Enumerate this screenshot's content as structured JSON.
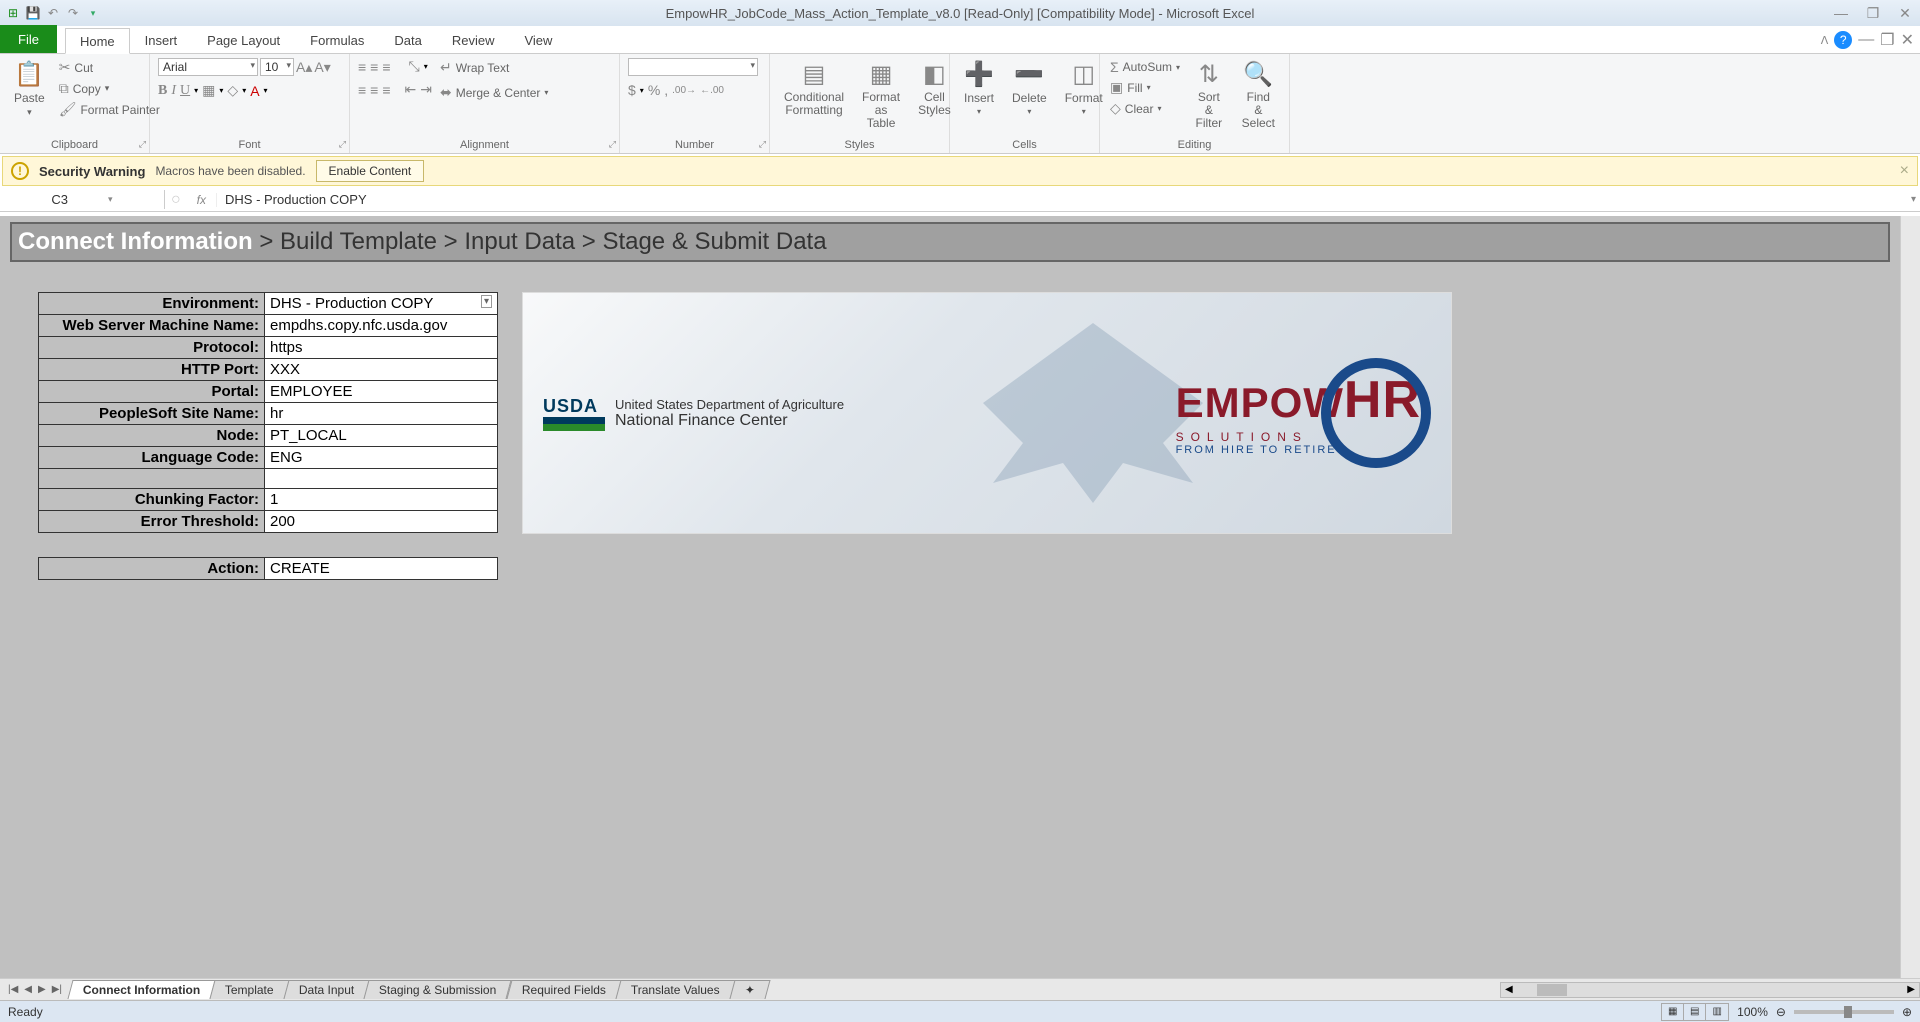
{
  "title": "EmpowHR_JobCode_Mass_Action_Template_v8.0  [Read-Only]  [Compatibility Mode] - Microsoft Excel",
  "ribbon_tabs": {
    "file": "File",
    "items": [
      "Home",
      "Insert",
      "Page Layout",
      "Formulas",
      "Data",
      "Review",
      "View"
    ],
    "active": "Home"
  },
  "clipboard": {
    "paste": "Paste",
    "cut": "Cut",
    "copy": "Copy",
    "fp": "Format Painter",
    "label": "Clipboard"
  },
  "font": {
    "name": "Arial",
    "size": "10",
    "label": "Font"
  },
  "alignment": {
    "wrap": "Wrap Text",
    "merge": "Merge & Center",
    "label": "Alignment"
  },
  "number": {
    "label": "Number"
  },
  "styles": {
    "cond": "Conditional Formatting",
    "fat": "Format as Table",
    "cell": "Cell Styles",
    "label": "Styles"
  },
  "cells": {
    "insert": "Insert",
    "delete": "Delete",
    "format": "Format",
    "label": "Cells"
  },
  "editing": {
    "autosum": "AutoSum",
    "fill": "Fill",
    "clear": "Clear",
    "sort": "Sort & Filter",
    "find": "Find & Select",
    "label": "Editing"
  },
  "security": {
    "title": "Security Warning",
    "msg": "Macros have been disabled.",
    "btn": "Enable Content"
  },
  "namebox": "C3",
  "formula": "DHS - Production COPY",
  "breadcrumb": {
    "active": "Connect Information",
    "rest": " > Build Template  > Input Data > Stage & Submit Data"
  },
  "form": {
    "rows": [
      {
        "label": "Environment:",
        "value": "DHS - Production COPY",
        "dropdown": true
      },
      {
        "label": "Web Server Machine Name:",
        "value": "empdhs.copy.nfc.usda.gov"
      },
      {
        "label": "Protocol:",
        "value": "https"
      },
      {
        "label": "HTTP Port:",
        "value": "XXX"
      },
      {
        "label": "Portal:",
        "value": "EMPLOYEE"
      },
      {
        "label": "PeopleSoft Site Name:",
        "value": "hr"
      },
      {
        "label": "Node:",
        "value": "PT_LOCAL"
      },
      {
        "label": "Language Code:",
        "value": "ENG"
      }
    ],
    "rows2": [
      {
        "label": "Chunking Factor:",
        "value": "1"
      },
      {
        "label": "Error Threshold:",
        "value": "200"
      }
    ],
    "rows3": [
      {
        "label": "Action:",
        "value": "CREATE"
      }
    ]
  },
  "logo": {
    "usda": "USDA",
    "dept": "United States Department of Agriculture",
    "nfc": "National Finance Center",
    "eh": "EMPOW",
    "hr": "HR",
    "sol": "SOLUTIONS",
    "tag": "FROM HIRE TO RETIRE"
  },
  "sheet_tabs": [
    "Connect Information",
    "Template",
    "Data Input",
    "Staging & Submission",
    "Required Fields",
    "Translate Values"
  ],
  "sheet_active": "Connect Information",
  "status": {
    "ready": "Ready",
    "zoom": "100%"
  }
}
